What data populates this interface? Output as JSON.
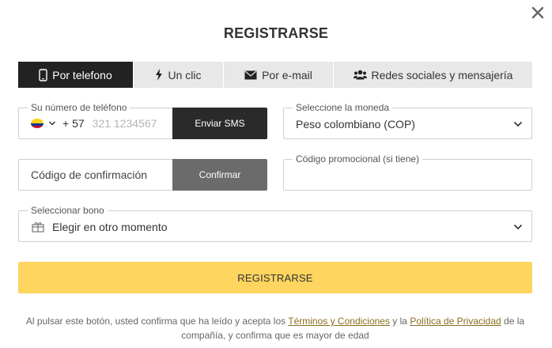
{
  "modal": {
    "title": "REGISTRARSE",
    "close_icon": "close-icon"
  },
  "tabs": [
    {
      "label": "Por telefono",
      "icon": "phone-icon",
      "active": true
    },
    {
      "label": "Un clic",
      "icon": "lightning-icon",
      "active": false
    },
    {
      "label": "Por e-mail",
      "icon": "envelope-icon",
      "active": false
    },
    {
      "label": "Redes sociales y mensajería",
      "icon": "users-icon",
      "active": false
    }
  ],
  "phone": {
    "label": "Su número de teléfono",
    "country_flag": "colombia-flag-icon",
    "prefix": "+ 57",
    "placeholder": "321 1234567",
    "sms_button": "Enviar SMS"
  },
  "currency": {
    "label": "Seleccione la moneda",
    "value": "Peso colombiano (COP)"
  },
  "confirmation": {
    "placeholder": "Código de confirmación",
    "button": "Confirmar"
  },
  "promo": {
    "label": "Código promocional (si tiene)",
    "value": ""
  },
  "bonus": {
    "label": "Seleccionar bono",
    "icon": "gift-icon",
    "value": "Elegir en otro momento"
  },
  "register_button": "REGISTRARSE",
  "legal": {
    "text_1": "Al pulsar este botón, usted confirma que ha leído y acepta los ",
    "terms_link": "Términos y Condiciones",
    "text_2": " y la ",
    "privacy_link": "Política de Privacidad",
    "text_3": " de la compañía, y confirma que es mayor de edad"
  },
  "colors": {
    "active_tab": "#222222",
    "inactive_tab": "#e8e8e8",
    "register_button": "#fdd55f",
    "sms_button": "#2a2a2a",
    "confirm_button": "#6b6b6b",
    "link": "#8a6d1b"
  }
}
